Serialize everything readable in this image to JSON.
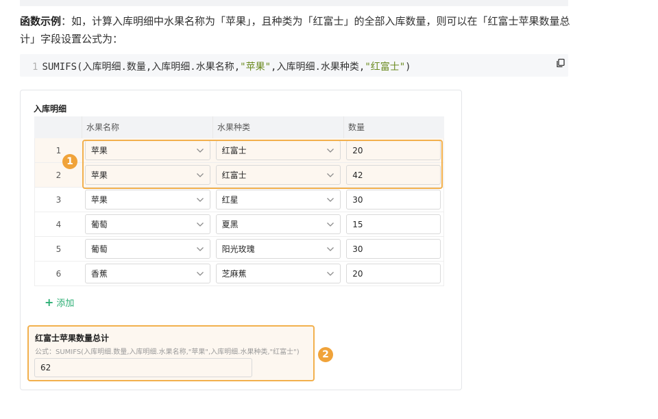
{
  "description": {
    "bold_prefix": "函数示例",
    "text": "：如，计算入库明细中水果名称为「苹果」，且种类为「红富士」的全部入库数量，则可以在「红富士苹果数量总计」字段设置公式为："
  },
  "code": {
    "line_number": "1",
    "part1": "SUMIFS(入库明细.数量,入库明细.水果名称,",
    "str1": "\"苹果\"",
    "part2": ",入库明细.水果种类,",
    "str2": "\"红富士\"",
    "part3": ")"
  },
  "icons": {
    "copy": "copy-icon",
    "chevron": "chevron-down-icon",
    "plus": "plus-icon"
  },
  "subform": {
    "title": "入库明细",
    "headers": {
      "index": "",
      "name": "水果名称",
      "type": "水果种类",
      "qty": "数量"
    },
    "rows": [
      {
        "index": "1",
        "name": "苹果",
        "type": "红富士",
        "qty": "20",
        "highlighted": true
      },
      {
        "index": "2",
        "name": "苹果",
        "type": "红富士",
        "qty": "42",
        "highlighted": true
      },
      {
        "index": "3",
        "name": "苹果",
        "type": "红星",
        "qty": "30",
        "highlighted": false
      },
      {
        "index": "4",
        "name": "葡萄",
        "type": "夏黑",
        "qty": "15",
        "highlighted": false
      },
      {
        "index": "5",
        "name": "葡萄",
        "type": "阳光玫瑰",
        "qty": "30",
        "highlighted": false
      },
      {
        "index": "6",
        "name": "香蕉",
        "type": "芝麻蕉",
        "qty": "20",
        "highlighted": false
      }
    ],
    "add_label": "添加"
  },
  "badges": {
    "first": "1",
    "second": "2"
  },
  "total_field": {
    "label": "红富士苹果数量总计",
    "formula": "公式：SUMIFS(入库明细.数量,入库明细.水果名称,\"苹果\",入库明细.水果种类,\"红富士\")",
    "value": "62"
  },
  "colors": {
    "highlight_border": "#f2b04d",
    "highlight_bg": "#fdf7f0",
    "badge": "#f0a33a",
    "accent_green": "#2cae74",
    "code_string": "#6a8a1f"
  }
}
